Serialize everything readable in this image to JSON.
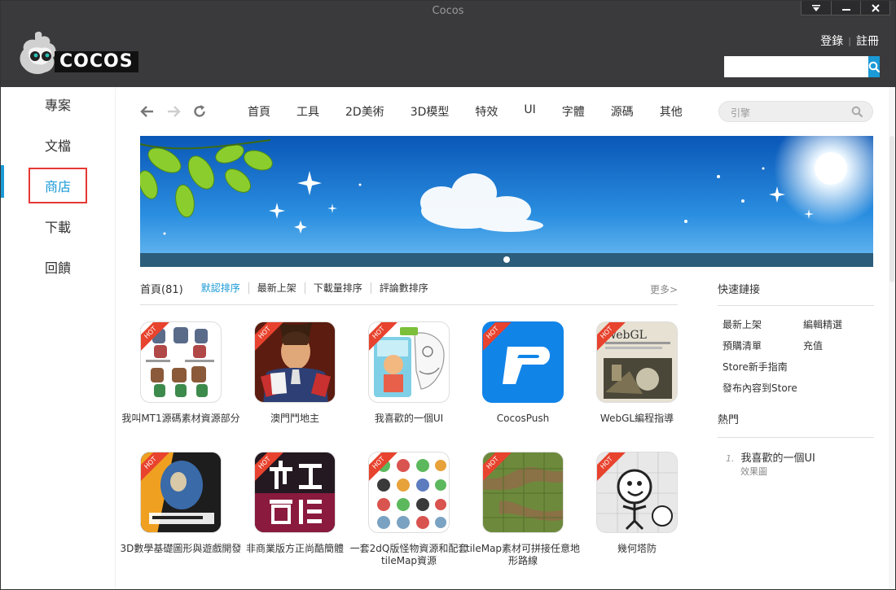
{
  "window": {
    "title": "Cocos"
  },
  "header": {
    "logo_text": "COCOS",
    "login": "登錄",
    "register": "註冊",
    "search_value": ""
  },
  "sidebar": {
    "items": [
      {
        "label": "專案",
        "active": false
      },
      {
        "label": "文檔",
        "active": false
      },
      {
        "label": "商店",
        "active": true
      },
      {
        "label": "下載",
        "active": false
      },
      {
        "label": "回饋",
        "active": false
      }
    ]
  },
  "nav": {
    "menu": [
      "首頁",
      "工具",
      "2D美術",
      "3D模型",
      "特效",
      "UI",
      "字體",
      "源碼",
      "其他"
    ],
    "search_placeholder": "引擎"
  },
  "sortbar": {
    "home": "首頁(81)",
    "options": [
      "默認排序",
      "最新上架",
      "下載量排序",
      "評論數排序"
    ],
    "active_index": 0,
    "more": "更多>"
  },
  "products": [
    {
      "name": "我叫MT1源碼素材資源部分",
      "hot": true,
      "icon": "sprites-grid-icon"
    },
    {
      "name": "澳門鬥地主",
      "hot": true,
      "icon": "card-player-icon"
    },
    {
      "name": "我喜歡的一個UI",
      "hot": true,
      "icon": "cartoon-character-icon"
    },
    {
      "name": "CocosPush",
      "hot": true,
      "icon": "cocospush-logo-icon"
    },
    {
      "name": "WebGL編程指導",
      "hot": true,
      "icon": "webgl-book-icon"
    },
    {
      "name": "3D數學基礎圖形與遊戲開發",
      "hot": true,
      "icon": "math-book-icon"
    },
    {
      "name": "非商業版方正尚酷簡體",
      "hot": true,
      "icon": "font-preview-icon"
    },
    {
      "name": "一套2dQ版怪物資源和配套tileMap資源",
      "hot": true,
      "icon": "monster-grid-icon"
    },
    {
      "name": "tileMap素材可拼接任意地形路線",
      "hot": true,
      "icon": "tilemap-grass-icon"
    },
    {
      "name": "幾何塔防",
      "hot": true,
      "icon": "doodle-tower-icon"
    }
  ],
  "hot_badge": "HOT",
  "quick_links": {
    "title": "快速鏈接",
    "items": [
      "最新上架",
      "編輯精選",
      "預購清單",
      "充值",
      "Store新手指南",
      "發布內容到Store"
    ]
  },
  "popular": {
    "title": "熱門",
    "items": [
      {
        "rank": "1.",
        "name": "我喜歡的一個UI",
        "sub": "效果圖"
      }
    ]
  },
  "colors": {
    "accent": "#1a9ad6",
    "header_bg": "#3a3a3c",
    "highlight_border": "#e53935",
    "hot_ribbon": "#e8432e"
  }
}
